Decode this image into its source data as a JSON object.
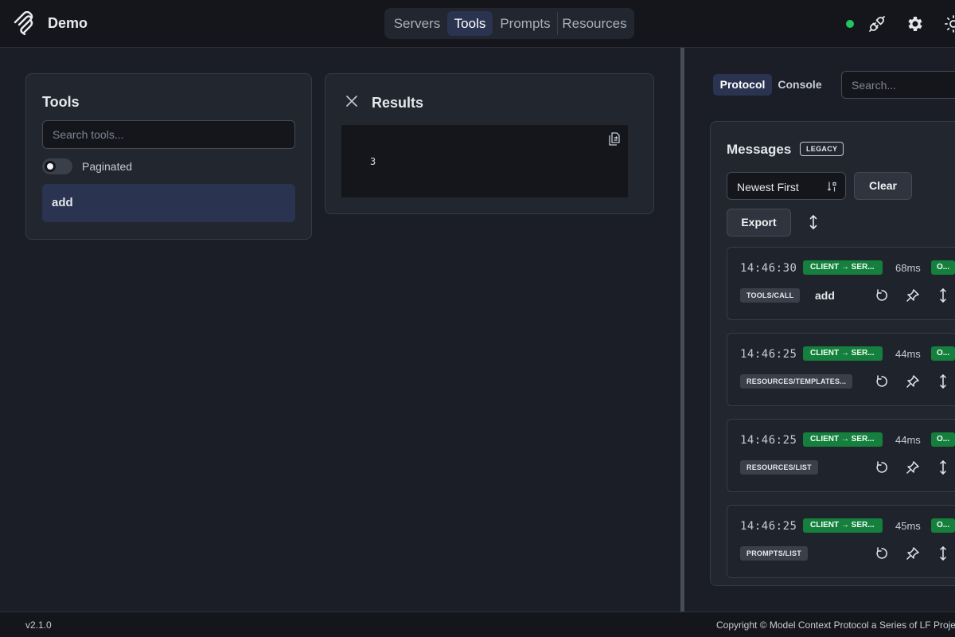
{
  "header": {
    "app_name": "Demo",
    "nav": [
      {
        "label": "Servers",
        "active": false
      },
      {
        "label": "Tools",
        "active": true
      },
      {
        "label": "Prompts",
        "active": false
      },
      {
        "label": "Resources",
        "active": false
      }
    ],
    "icons": [
      "connection-status-dot",
      "plug-icon",
      "gear-icon",
      "sun-icon"
    ],
    "status_color": "#22c55e"
  },
  "tools_panel": {
    "title": "Tools",
    "search_placeholder": "Search tools...",
    "paginated_label": "Paginated",
    "items": [
      "add"
    ]
  },
  "results_panel": {
    "title": "Results",
    "value": "3"
  },
  "right_panel": {
    "tabs": [
      {
        "label": "Protocol",
        "active": true
      },
      {
        "label": "Console",
        "active": false
      }
    ],
    "search_placeholder": "Search...",
    "messages": {
      "title": "Messages",
      "badge": "LEGACY",
      "sort": "Newest First",
      "clear_label": "Clear",
      "export_label": "Export",
      "items": [
        {
          "time": "14:46:30",
          "direction": "CLIENT → SER...",
          "duration": "68ms",
          "status": "O...",
          "method": "TOOLS/CALL",
          "name": "add"
        },
        {
          "time": "14:46:25",
          "direction": "CLIENT → SER...",
          "duration": "44ms",
          "status": "O...",
          "method": "RESOURCES/TEMPLATES...",
          "name": ""
        },
        {
          "time": "14:46:25",
          "direction": "CLIENT → SER...",
          "duration": "44ms",
          "status": "O...",
          "method": "RESOURCES/LIST",
          "name": ""
        },
        {
          "time": "14:46:25",
          "direction": "CLIENT → SER...",
          "duration": "45ms",
          "status": "O...",
          "method": "PROMPTS/LIST",
          "name": ""
        }
      ]
    }
  },
  "footer": {
    "version": "v2.1.0",
    "copyright": "Copyright © Model Context Protocol a Series of LF Proje"
  }
}
